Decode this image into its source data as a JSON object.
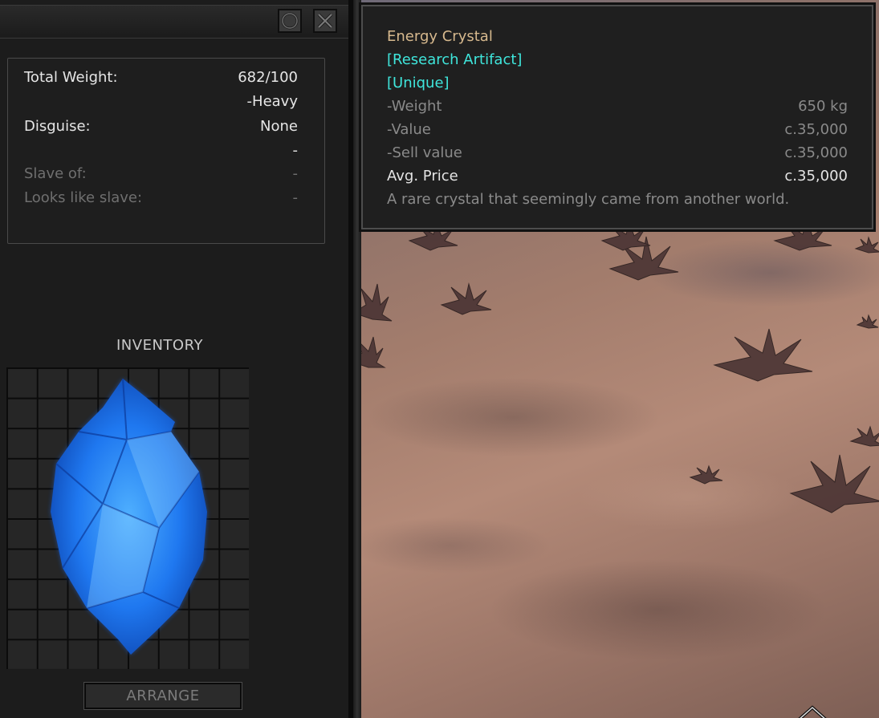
{
  "colors": {
    "panel_bg": "#1c1c1c",
    "item_name": "#d7b98e",
    "tag": "#3fe6dc",
    "dim_text": "#6f6f6f",
    "bright_text": "#e6e6e6",
    "crystal": "#2f8fff"
  },
  "window": {
    "buttons": [
      {
        "icon": "eye-icon"
      },
      {
        "icon": "close-icon"
      }
    ]
  },
  "stats": {
    "total_weight_label": "Total Weight:",
    "total_weight_value": "682/100",
    "weight_status": "-Heavy",
    "disguise_label": "Disguise:",
    "disguise_value": "None",
    "disguise_extra": "-",
    "slave_of_label": "Slave of:",
    "slave_of_value": "-",
    "looks_like_slave_label": "Looks like slave:",
    "looks_like_slave_value": "-"
  },
  "inventory": {
    "title": "INVENTORY",
    "item_icon": "energy-crystal-icon",
    "arrange_label": "ARRANGE"
  },
  "tooltip": {
    "item_name": "Energy Crystal",
    "tags": [
      "[Research Artifact]",
      "[Unique]"
    ],
    "rows": [
      {
        "label": "-Weight",
        "value": "650 kg"
      },
      {
        "label": "-Value",
        "value": "c.35,000"
      },
      {
        "label": "-Sell value",
        "value": "c.35,000"
      },
      {
        "label": "Avg. Price",
        "value": "c.35,000"
      }
    ],
    "description": "A rare crystal that seemingly came from another world."
  }
}
